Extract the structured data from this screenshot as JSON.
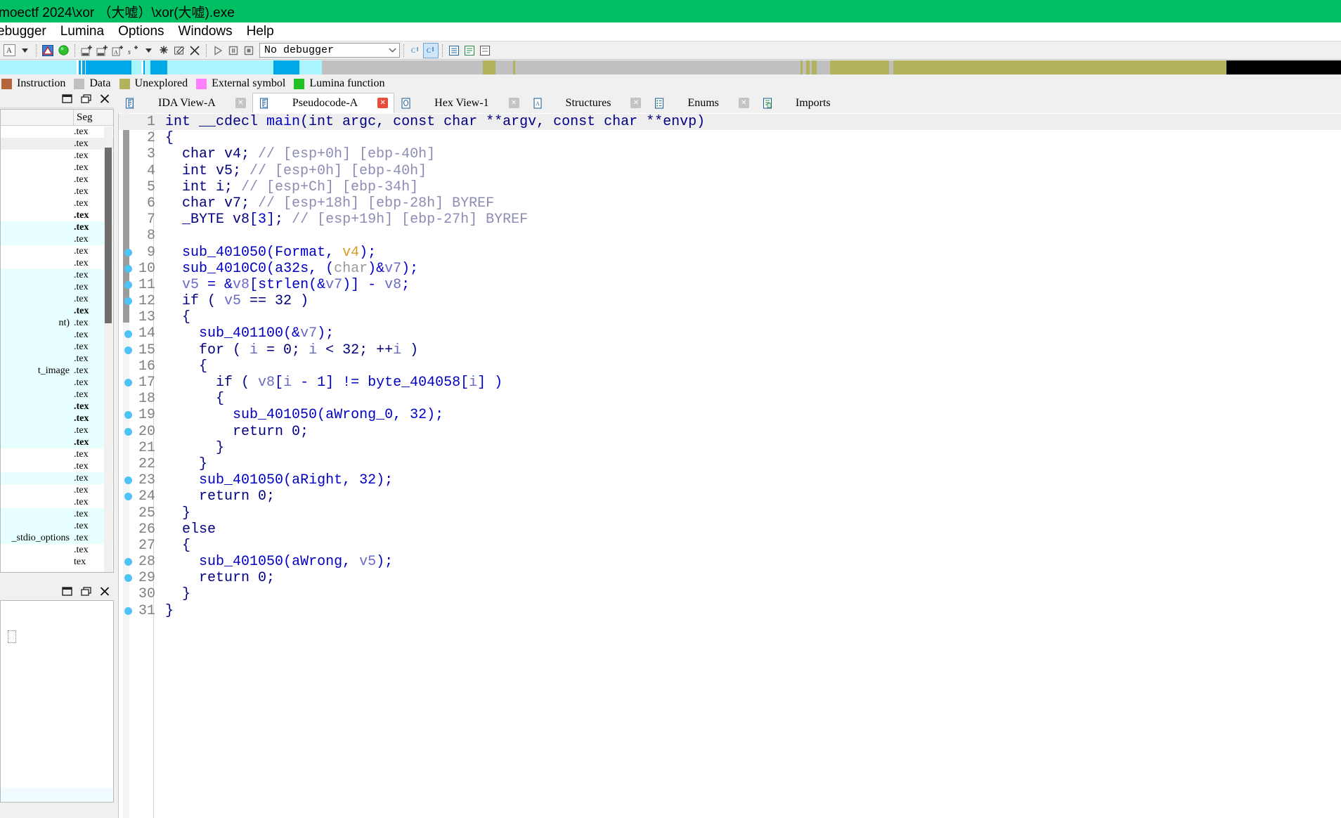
{
  "window": {
    "title": "moectf 2024\\xor （大嘘）\\xor(大嘘).exe",
    "titlebar_color": "#00bf63"
  },
  "menubar": {
    "items": [
      "ebugger",
      "Lumina",
      "Options",
      "Windows",
      "Help"
    ]
  },
  "toolbar": {
    "font_button": "A",
    "debugger_select": "No debugger",
    "chevron": "⌄",
    "buttons": [
      {
        "name": "font-button",
        "label": "A"
      },
      {
        "name": "dropdown-arrow",
        "label": "▼"
      },
      {
        "name": "warning-icon",
        "label": ""
      },
      {
        "name": "run-status-icon",
        "label": ""
      },
      {
        "name": "make-code-icon",
        "label": "CODE"
      },
      {
        "name": "make-data-icon",
        "label": "DATA"
      },
      {
        "name": "make-array-icon",
        "label": "A"
      },
      {
        "name": "make-string-icon",
        "label": "s"
      },
      {
        "name": "string-dropdown-arrow",
        "label": "▼"
      },
      {
        "name": "undefine-icon",
        "label": ""
      },
      {
        "name": "edit-function-icon",
        "label": ""
      },
      {
        "name": "delete-icon",
        "label": "✕"
      },
      {
        "name": "run-icon",
        "label": "▷"
      },
      {
        "name": "pause-icon",
        "label": ""
      },
      {
        "name": "stop-icon",
        "label": ""
      }
    ]
  },
  "navband": {
    "segments": [
      {
        "color": "#aaf4ff",
        "width": 7.05
      },
      {
        "color": "#ffffff",
        "width": 0.16
      },
      {
        "color": "#00a8e8",
        "width": 0.21
      },
      {
        "color": "#ffffff",
        "width": 0.16
      },
      {
        "color": "#00a8e8",
        "width": 0.21
      },
      {
        "color": "#ffffff",
        "width": 0.1
      },
      {
        "color": "#00a8e8",
        "width": 4.2
      },
      {
        "color": "#aaf4ff",
        "width": 0.9
      },
      {
        "color": "#ffffff",
        "width": 0.16
      },
      {
        "color": "#00a8e8",
        "width": 0.16
      },
      {
        "color": "#aaf4ff",
        "width": 0.52
      },
      {
        "color": "#00a8e8",
        "width": 1.57
      },
      {
        "color": "#aaf4ff",
        "width": 9.7
      },
      {
        "color": "#00a8e8",
        "width": 2.4
      },
      {
        "color": "#aaf4ff",
        "width": 2.05
      },
      {
        "color": "#c0c0c0",
        "width": 14.8
      },
      {
        "color": "#b3b35e",
        "width": 1.2
      },
      {
        "color": "#c0c0c0",
        "width": 1.6
      },
      {
        "color": "#b3b35e",
        "width": 0.18
      },
      {
        "color": "#c0c0c0",
        "width": 26.2
      },
      {
        "color": "#b3b35e",
        "width": 0.22
      },
      {
        "color": "#c0c0c0",
        "width": 0.35
      },
      {
        "color": "#b3b35e",
        "width": 0.3
      },
      {
        "color": "#c0c0c0",
        "width": 0.22
      },
      {
        "color": "#b3b35e",
        "width": 0.45
      },
      {
        "color": "#c0c0c0",
        "width": 1.2
      },
      {
        "color": "#b3b35e",
        "width": 5.4
      },
      {
        "color": "#c0c0c0",
        "width": 0.4
      },
      {
        "color": "#b3b35e",
        "width": 30.6
      },
      {
        "color": "#000000",
        "width": 10.55
      }
    ]
  },
  "legend": {
    "items": [
      {
        "label": "nction",
        "color": "#c08040",
        "hide_swatch": true
      },
      {
        "label": "Instruction",
        "color": "#b5643c"
      },
      {
        "label": "Data",
        "color": "#c0c0c0"
      },
      {
        "label": "Unexplored",
        "color": "#b3b35e"
      },
      {
        "label": "External symbol",
        "color": "#ff80ff"
      },
      {
        "label": "Lumina function",
        "color": "#22c022"
      }
    ]
  },
  "panels": {
    "functions": {
      "title_buttons": [
        "❐",
        "❐",
        "✕"
      ],
      "columns": [
        "",
        "Seg"
      ],
      "column_seg_label": "Seg",
      "rows": [
        {
          "name": "",
          "seg": ".tex",
          "style": ""
        },
        {
          "name": "",
          "seg": ".tex",
          "style": "sel-gray"
        },
        {
          "name": "",
          "seg": ".tex",
          "style": ""
        },
        {
          "name": "",
          "seg": ".tex",
          "style": ""
        },
        {
          "name": "",
          "seg": ".tex",
          "style": ""
        },
        {
          "name": "",
          "seg": ".tex",
          "style": ""
        },
        {
          "name": "",
          "seg": ".tex",
          "style": ""
        },
        {
          "name": "",
          "seg": ".tex",
          "style": "bold"
        },
        {
          "name": "",
          "seg": ".tex",
          "style": "bold sel-lib"
        },
        {
          "name": "",
          "seg": ".tex",
          "style": "sel-lib"
        },
        {
          "name": "",
          "seg": ".tex",
          "style": ""
        },
        {
          "name": "",
          "seg": ".tex",
          "style": ""
        },
        {
          "name": "",
          "seg": ".tex",
          "style": "sel-lib"
        },
        {
          "name": "",
          "seg": ".tex",
          "style": "sel-lib"
        },
        {
          "name": "",
          "seg": ".tex",
          "style": "sel-lib"
        },
        {
          "name": "",
          "seg": ".tex",
          "style": "bold sel-lib"
        },
        {
          "name": "nt)",
          "seg": ".tex",
          "style": "sel-lib"
        },
        {
          "name": "",
          "seg": ".tex",
          "style": "sel-lib"
        },
        {
          "name": "",
          "seg": ".tex",
          "style": "sel-lib"
        },
        {
          "name": "",
          "seg": ".tex",
          "style": "sel-lib"
        },
        {
          "name": "t_image",
          "seg": ".tex",
          "style": "sel-lib"
        },
        {
          "name": "",
          "seg": ".tex",
          "style": "sel-lib"
        },
        {
          "name": "",
          "seg": ".tex",
          "style": "sel-lib"
        },
        {
          "name": "",
          "seg": ".tex",
          "style": "bold sel-lib"
        },
        {
          "name": "",
          "seg": ".tex",
          "style": "bold sel-lib"
        },
        {
          "name": "",
          "seg": ".tex",
          "style": "sel-lib"
        },
        {
          "name": "",
          "seg": ".tex",
          "style": "bold sel-lib"
        },
        {
          "name": "",
          "seg": ".tex",
          "style": ""
        },
        {
          "name": "",
          "seg": ".tex",
          "style": ""
        },
        {
          "name": "",
          "seg": ".tex",
          "style": "sel-lib"
        },
        {
          "name": "",
          "seg": ".tex",
          "style": ""
        },
        {
          "name": "",
          "seg": ".tex",
          "style": ""
        },
        {
          "name": "",
          "seg": ".tex",
          "style": "sel-lib"
        },
        {
          "name": "",
          "seg": ".tex",
          "style": "sel-lib"
        },
        {
          "name": "_stdio_options",
          "seg": ".tex",
          "style": "sel-lib"
        },
        {
          "name": "",
          "seg": ".tex",
          "style": ""
        },
        {
          "name": "",
          "seg": "tex",
          "style": ""
        }
      ]
    },
    "output": {
      "title_buttons": [
        "❐",
        "❐",
        "✕"
      ]
    }
  },
  "tabs": [
    {
      "label": "IDA View-A",
      "icon": "document-icon",
      "active": false,
      "close": "✕"
    },
    {
      "label": "Pseudocode-A",
      "icon": "document-icon",
      "active": true,
      "close": "✕"
    },
    {
      "label": "Hex View-1",
      "icon": "hex-icon",
      "active": false,
      "close": "✕"
    },
    {
      "label": "Structures",
      "icon": "struct-icon",
      "active": false,
      "close": "✕"
    },
    {
      "label": "Enums",
      "icon": "enum-icon",
      "active": false,
      "close": "✕"
    },
    {
      "label": "Imports",
      "icon": "imports-icon",
      "active": false,
      "close": ""
    }
  ],
  "pseudocode": {
    "lines": [
      {
        "n": 1,
        "bp": false,
        "hl": true,
        "tokens": [
          {
            "t": "int __cdecl ",
            "c": "k"
          },
          {
            "t": "main",
            "c": "fn"
          },
          {
            "t": "(int argc, const char **argv, const char **envp)",
            "c": "k"
          }
        ]
      },
      {
        "n": 2,
        "bp": false,
        "hl": false,
        "tokens": [
          {
            "t": "{",
            "c": "k"
          }
        ]
      },
      {
        "n": 3,
        "bp": false,
        "hl": false,
        "tokens": [
          {
            "t": "  char v4; ",
            "c": "k"
          },
          {
            "t": "// [esp+0h] [ebp-40h]",
            "c": "cmt"
          }
        ]
      },
      {
        "n": 4,
        "bp": false,
        "hl": false,
        "tokens": [
          {
            "t": "  int v5; ",
            "c": "k"
          },
          {
            "t": "// [esp+0h] [ebp-40h]",
            "c": "cmt"
          }
        ]
      },
      {
        "n": 5,
        "bp": false,
        "hl": false,
        "tokens": [
          {
            "t": "  int i; ",
            "c": "k"
          },
          {
            "t": "// [esp+Ch] [ebp-34h]",
            "c": "cmt"
          }
        ]
      },
      {
        "n": 6,
        "bp": false,
        "hl": false,
        "tokens": [
          {
            "t": "  char v7; ",
            "c": "k"
          },
          {
            "t": "// [esp+18h] [ebp-28h] BYREF",
            "c": "cmt"
          }
        ]
      },
      {
        "n": 7,
        "bp": false,
        "hl": false,
        "tokens": [
          {
            "t": "  _BYTE v8",
            "c": "k"
          },
          {
            "t": "[3]",
            "c": "glob"
          },
          {
            "t": "; ",
            "c": "k"
          },
          {
            "t": "// [esp+19h] [ebp-27h] BYREF",
            "c": "cmt"
          }
        ]
      },
      {
        "n": 8,
        "bp": false,
        "hl": false,
        "tokens": [
          {
            "t": "",
            "c": "k"
          }
        ]
      },
      {
        "n": 9,
        "bp": true,
        "hl": false,
        "tokens": [
          {
            "t": "  ",
            "c": "k"
          },
          {
            "t": "sub_401050",
            "c": "fn"
          },
          {
            "t": "(",
            "c": "glob"
          },
          {
            "t": "Format",
            "c": "fn"
          },
          {
            "t": ", ",
            "c": "glob"
          },
          {
            "t": "v4",
            "c": "varo"
          },
          {
            "t": ");",
            "c": "glob"
          }
        ]
      },
      {
        "n": 10,
        "bp": true,
        "hl": false,
        "tokens": [
          {
            "t": "  ",
            "c": "k"
          },
          {
            "t": "sub_4010C0",
            "c": "fn"
          },
          {
            "t": "(",
            "c": "glob"
          },
          {
            "t": "a32s",
            "c": "fn"
          },
          {
            "t": ", (",
            "c": "glob"
          },
          {
            "t": "char",
            "c": "cast"
          },
          {
            "t": ")&",
            "c": "glob"
          },
          {
            "t": "v7",
            "c": "var"
          },
          {
            "t": ");",
            "c": "glob"
          }
        ]
      },
      {
        "n": 11,
        "bp": true,
        "hl": false,
        "tokens": [
          {
            "t": "  ",
            "c": "k"
          },
          {
            "t": "v5",
            "c": "var"
          },
          {
            "t": " = &",
            "c": "glob"
          },
          {
            "t": "v8",
            "c": "var"
          },
          {
            "t": "[",
            "c": "glob"
          },
          {
            "t": "strlen",
            "c": "fn"
          },
          {
            "t": "(&",
            "c": "glob"
          },
          {
            "t": "v7",
            "c": "var"
          },
          {
            "t": ")] - ",
            "c": "glob"
          },
          {
            "t": "v8",
            "c": "var"
          },
          {
            "t": ";",
            "c": "glob"
          }
        ]
      },
      {
        "n": 12,
        "bp": true,
        "hl": false,
        "tokens": [
          {
            "t": "  if ( ",
            "c": "k"
          },
          {
            "t": "v5",
            "c": "var"
          },
          {
            "t": " == ",
            "c": "k"
          },
          {
            "t": "32",
            "c": "num"
          },
          {
            "t": " )",
            "c": "k"
          }
        ]
      },
      {
        "n": 13,
        "bp": false,
        "hl": false,
        "tokens": [
          {
            "t": "  {",
            "c": "k"
          }
        ]
      },
      {
        "n": 14,
        "bp": true,
        "hl": false,
        "tokens": [
          {
            "t": "    ",
            "c": "k"
          },
          {
            "t": "sub_401100",
            "c": "fn"
          },
          {
            "t": "(&",
            "c": "glob"
          },
          {
            "t": "v7",
            "c": "var"
          },
          {
            "t": ");",
            "c": "glob"
          }
        ]
      },
      {
        "n": 15,
        "bp": true,
        "hl": false,
        "tokens": [
          {
            "t": "    for ( ",
            "c": "k"
          },
          {
            "t": "i",
            "c": "var"
          },
          {
            "t": " = 0; ",
            "c": "k"
          },
          {
            "t": "i",
            "c": "var"
          },
          {
            "t": " < 32; ++",
            "c": "k"
          },
          {
            "t": "i",
            "c": "var"
          },
          {
            "t": " )",
            "c": "k"
          }
        ]
      },
      {
        "n": 16,
        "bp": false,
        "hl": false,
        "tokens": [
          {
            "t": "    {",
            "c": "k"
          }
        ]
      },
      {
        "n": 17,
        "bp": true,
        "hl": false,
        "tokens": [
          {
            "t": "      if ( ",
            "c": "k"
          },
          {
            "t": "v8",
            "c": "var"
          },
          {
            "t": "[",
            "c": "glob"
          },
          {
            "t": "i",
            "c": "var"
          },
          {
            "t": " - 1] != ",
            "c": "glob"
          },
          {
            "t": "byte_404058",
            "c": "fn"
          },
          {
            "t": "[",
            "c": "glob"
          },
          {
            "t": "i",
            "c": "var"
          },
          {
            "t": "] )",
            "c": "glob"
          }
        ]
      },
      {
        "n": 18,
        "bp": false,
        "hl": false,
        "tokens": [
          {
            "t": "      {",
            "c": "k"
          }
        ]
      },
      {
        "n": 19,
        "bp": true,
        "hl": false,
        "tokens": [
          {
            "t": "        ",
            "c": "k"
          },
          {
            "t": "sub_401050",
            "c": "fn"
          },
          {
            "t": "(",
            "c": "glob"
          },
          {
            "t": "aWrong_0",
            "c": "fn"
          },
          {
            "t": ", 32);",
            "c": "glob"
          }
        ]
      },
      {
        "n": 20,
        "bp": true,
        "hl": false,
        "tokens": [
          {
            "t": "        return 0;",
            "c": "k"
          }
        ]
      },
      {
        "n": 21,
        "bp": false,
        "hl": false,
        "tokens": [
          {
            "t": "      }",
            "c": "k"
          }
        ]
      },
      {
        "n": 22,
        "bp": false,
        "hl": false,
        "tokens": [
          {
            "t": "    }",
            "c": "k"
          }
        ]
      },
      {
        "n": 23,
        "bp": true,
        "hl": false,
        "tokens": [
          {
            "t": "    ",
            "c": "k"
          },
          {
            "t": "sub_401050",
            "c": "fn"
          },
          {
            "t": "(",
            "c": "glob"
          },
          {
            "t": "aRight",
            "c": "fn"
          },
          {
            "t": ", 32);",
            "c": "glob"
          }
        ]
      },
      {
        "n": 24,
        "bp": true,
        "hl": false,
        "tokens": [
          {
            "t": "    return 0;",
            "c": "k"
          }
        ]
      },
      {
        "n": 25,
        "bp": false,
        "hl": false,
        "tokens": [
          {
            "t": "  }",
            "c": "k"
          }
        ]
      },
      {
        "n": 26,
        "bp": false,
        "hl": false,
        "tokens": [
          {
            "t": "  else",
            "c": "k"
          }
        ]
      },
      {
        "n": 27,
        "bp": false,
        "hl": false,
        "tokens": [
          {
            "t": "  {",
            "c": "k"
          }
        ]
      },
      {
        "n": 28,
        "bp": true,
        "hl": false,
        "tokens": [
          {
            "t": "    ",
            "c": "k"
          },
          {
            "t": "sub_401050",
            "c": "fn"
          },
          {
            "t": "(",
            "c": "glob"
          },
          {
            "t": "aWrong",
            "c": "fn"
          },
          {
            "t": ", ",
            "c": "glob"
          },
          {
            "t": "v5",
            "c": "var"
          },
          {
            "t": ");",
            "c": "glob"
          }
        ]
      },
      {
        "n": 29,
        "bp": true,
        "hl": false,
        "tokens": [
          {
            "t": "    return 0;",
            "c": "k"
          }
        ]
      },
      {
        "n": 30,
        "bp": false,
        "hl": false,
        "tokens": [
          {
            "t": "  }",
            "c": "k"
          }
        ]
      },
      {
        "n": 31,
        "bp": true,
        "hl": false,
        "tokens": [
          {
            "t": "}",
            "c": "k"
          }
        ]
      }
    ]
  }
}
